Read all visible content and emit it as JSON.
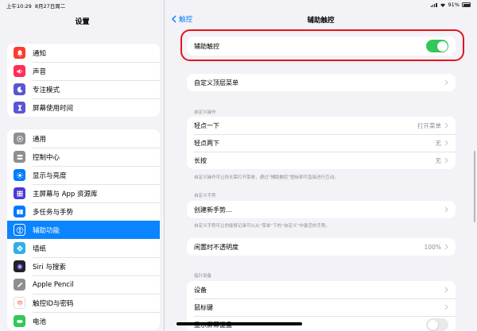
{
  "status_bar": {
    "time": "上午10:29",
    "date": "8月27日周二",
    "battery": "91%"
  },
  "sidebar": {
    "title": "设置",
    "groups": [
      [
        {
          "label": "通知",
          "icon": "bell-icon",
          "color": "#ff3b30"
        },
        {
          "label": "声音",
          "icon": "speaker-icon",
          "color": "#ff2d55"
        },
        {
          "label": "专注模式",
          "icon": "moon-icon",
          "color": "#5856d6"
        },
        {
          "label": "屏幕使用时间",
          "icon": "hourglass-icon",
          "color": "#5856d6"
        }
      ],
      [
        {
          "label": "通用",
          "icon": "gear-icon",
          "color": "#8e8e93"
        },
        {
          "label": "控制中心",
          "icon": "switches-icon",
          "color": "#8e8e93"
        },
        {
          "label": "显示与亮度",
          "icon": "sun-icon",
          "color": "#007aff"
        },
        {
          "label": "主屏幕与 App 资源库",
          "icon": "grid-icon",
          "color": "#4c3ad6"
        },
        {
          "label": "多任务与手势",
          "icon": "multitask-icon",
          "color": "#007aff"
        },
        {
          "label": "辅助功能",
          "icon": "accessibility-icon",
          "color": "#007aff",
          "active": true
        },
        {
          "label": "墙纸",
          "icon": "flower-icon",
          "color": "#32ade6"
        },
        {
          "label": "Siri 与搜索",
          "icon": "siri-icon",
          "color": "#222222"
        },
        {
          "label": "Apple Pencil",
          "icon": "pencil-icon",
          "color": "#8e8e93"
        },
        {
          "label": "触控ID与密码",
          "icon": "fingerprint-icon",
          "color": "#ffffff"
        },
        {
          "label": "电池",
          "icon": "battery-icon",
          "color": "#34c759"
        }
      ]
    ]
  },
  "main": {
    "back_label": "触控",
    "title": "辅助触控",
    "assistive_touch": {
      "label": "辅助触控",
      "enabled": true
    },
    "top_menu": {
      "label": "自定义顶层菜单"
    },
    "custom_actions": {
      "header": "自定义操作",
      "rows": [
        {
          "label": "轻点一下",
          "value": "打开菜单"
        },
        {
          "label": "轻点两下",
          "value": "无"
        },
        {
          "label": "长按",
          "value": "无"
        }
      ],
      "footer": "自定义操作可让你无需打开菜单，通过“辅助触控”图标即可直接进行互动。"
    },
    "custom_gestures": {
      "header": "自定义手势",
      "create_label": "创建新手势…",
      "footer": "自定义手势可让你能够记录可以从“菜单”下的“自定义”中激活的手势。"
    },
    "idle_opacity": {
      "label": "闲置时不透明度",
      "value": "100%"
    },
    "pointer_devices": {
      "header": "指针设备",
      "rows": [
        {
          "label": "设备"
        },
        {
          "label": "鼠标键"
        },
        {
          "label": "显示屏幕键盘"
        }
      ],
      "keyboard_toggle": false
    }
  }
}
